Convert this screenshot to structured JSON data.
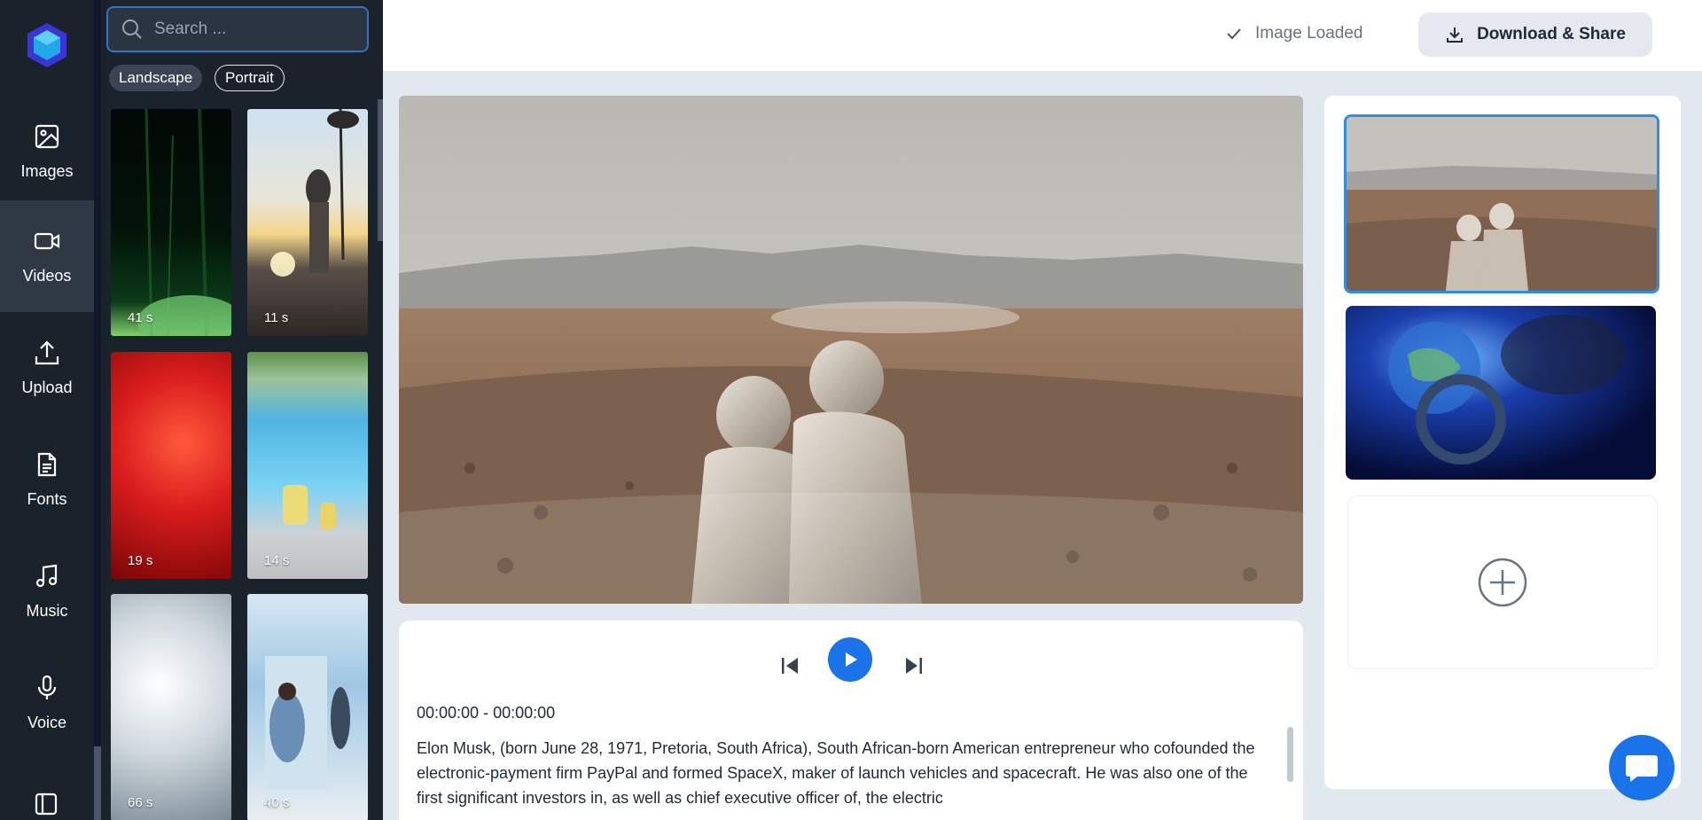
{
  "nav": {
    "items": [
      {
        "label": "Images",
        "icon": "image-icon"
      },
      {
        "label": "Videos",
        "icon": "video-icon",
        "active": true
      },
      {
        "label": "Upload",
        "icon": "upload-icon"
      },
      {
        "label": "Fonts",
        "icon": "document-icon"
      },
      {
        "label": "Music",
        "icon": "music-icon"
      },
      {
        "label": "Voice",
        "icon": "microphone-icon"
      }
    ]
  },
  "media": {
    "search_placeholder": "Search ...",
    "filters": [
      "Landscape",
      "Portrait"
    ],
    "selected_filter": "Portrait",
    "videos": [
      {
        "duration": "41 s"
      },
      {
        "duration": "11 s"
      },
      {
        "duration": "19 s"
      },
      {
        "duration": "14 s"
      },
      {
        "duration": "66 s"
      },
      {
        "duration": "40 s"
      }
    ]
  },
  "topbar": {
    "status": "Image Loaded",
    "download_label": "Download & Share"
  },
  "player": {
    "time_range": "00:00:00 - 00:00:00",
    "description": "Elon Musk, (born June 28, 1971, Pretoria, South Africa), South African-born American entrepreneur who cofounded the electronic-payment firm PayPal and formed SpaceX, maker of launch vehicles and spacecraft. He was also one of the first significant investors in, as well as chief executive officer of, the electric"
  },
  "colors": {
    "accent": "#1a73e8",
    "sidebar": "#1a222c",
    "selected_border": "#2f8de4"
  }
}
